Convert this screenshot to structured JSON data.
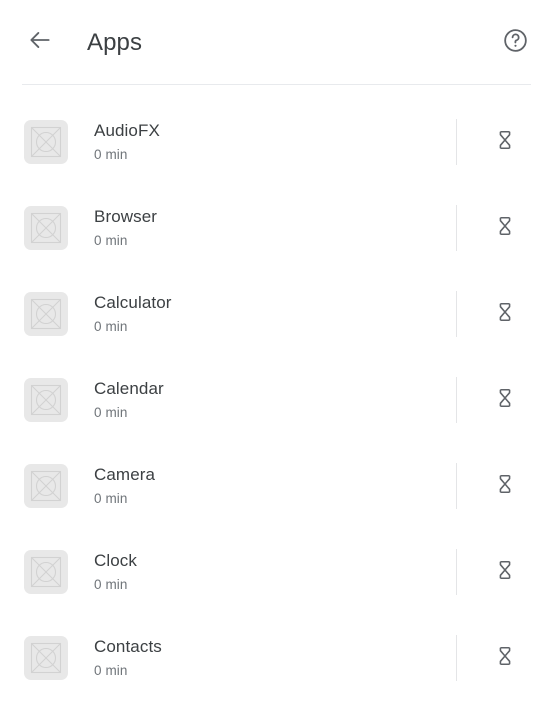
{
  "header": {
    "title": "Apps",
    "back_icon": "arrow-back-icon",
    "help_icon": "help-circle-icon"
  },
  "colors": {
    "background": "#ffffff",
    "title_text": "#3c4043",
    "primary_text": "#3c4043",
    "secondary_text": "#70757a",
    "icon": "#5f6368",
    "divider": "#e8eaed",
    "row_divider": "#e4e5e7",
    "app_icon_placeholder_bg": "#e8e8e8",
    "app_icon_placeholder_stroke": "#d2d2d2"
  },
  "list": {
    "timer_icon": "hourglass-icon",
    "placeholder_icon": "broken-image-placeholder-icon",
    "rows": [
      {
        "name": "AudioFX",
        "usage": "0 min"
      },
      {
        "name": "Browser",
        "usage": "0 min"
      },
      {
        "name": "Calculator",
        "usage": "0 min"
      },
      {
        "name": "Calendar",
        "usage": "0 min"
      },
      {
        "name": "Camera",
        "usage": "0 min"
      },
      {
        "name": "Clock",
        "usage": "0 min"
      },
      {
        "name": "Contacts",
        "usage": "0 min"
      }
    ]
  }
}
